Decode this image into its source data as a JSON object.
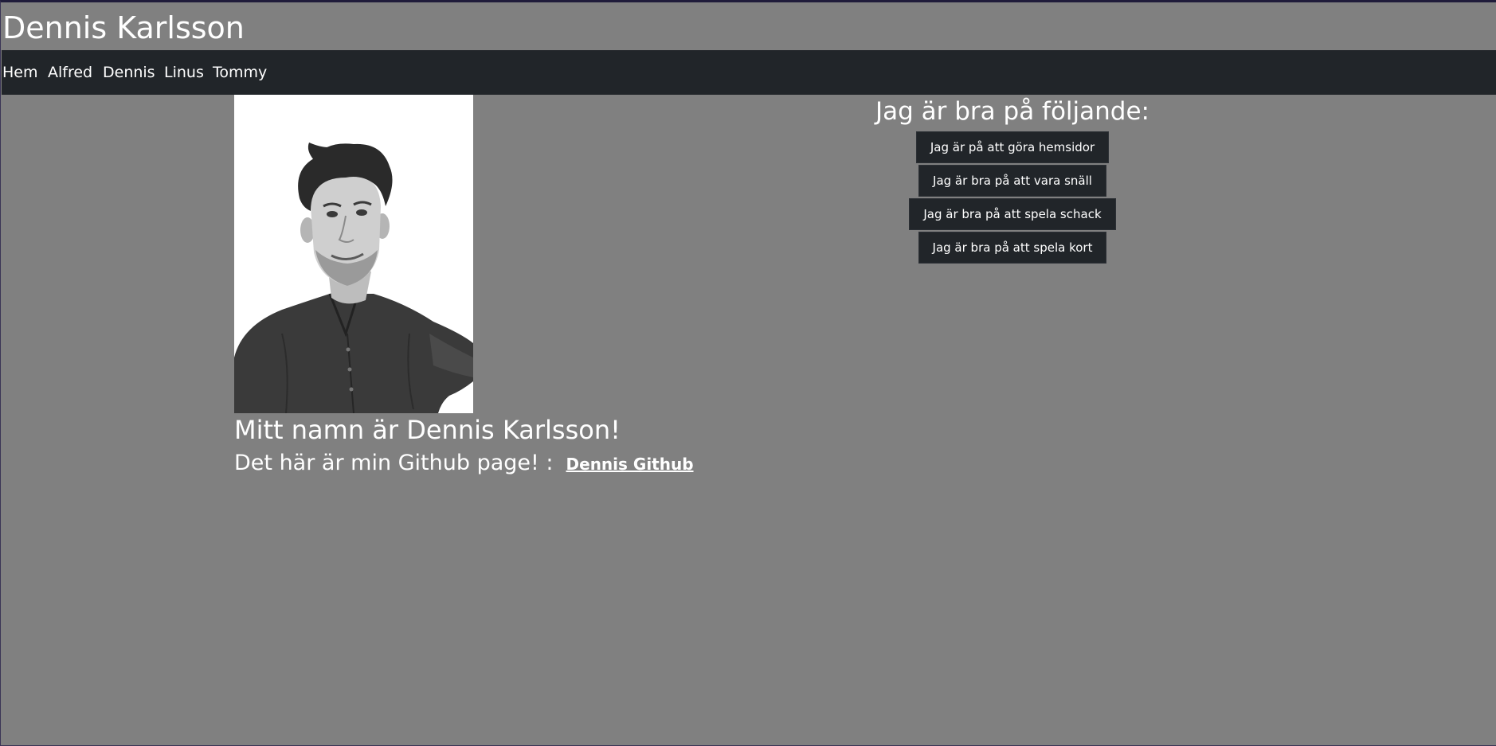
{
  "header": {
    "title": "Dennis Karlsson"
  },
  "nav": {
    "items": [
      {
        "label": "Hem"
      },
      {
        "label": "Alfred"
      },
      {
        "label": "Dennis"
      },
      {
        "label": "Linus"
      },
      {
        "label": "Tommy"
      }
    ]
  },
  "profile": {
    "photo_icon": "portrait-photo",
    "intro_heading": "Mitt namn är Dennis Karlsson!",
    "github_text": "Det här är min Github page! :",
    "github_link_label": "Dennis Github"
  },
  "skills": {
    "heading": "Jag är bra på följande:",
    "buttons": [
      {
        "label": "Jag är på att göra hemsidor"
      },
      {
        "label": "Jag är bra på att vara snäll"
      },
      {
        "label": "Jag är bra på att spela schack"
      },
      {
        "label": "Jag är bra på att spela kort"
      }
    ]
  },
  "colors": {
    "page_background": "#808080",
    "navbar_background": "#212529",
    "button_background": "#212529",
    "text": "#ffffff"
  }
}
